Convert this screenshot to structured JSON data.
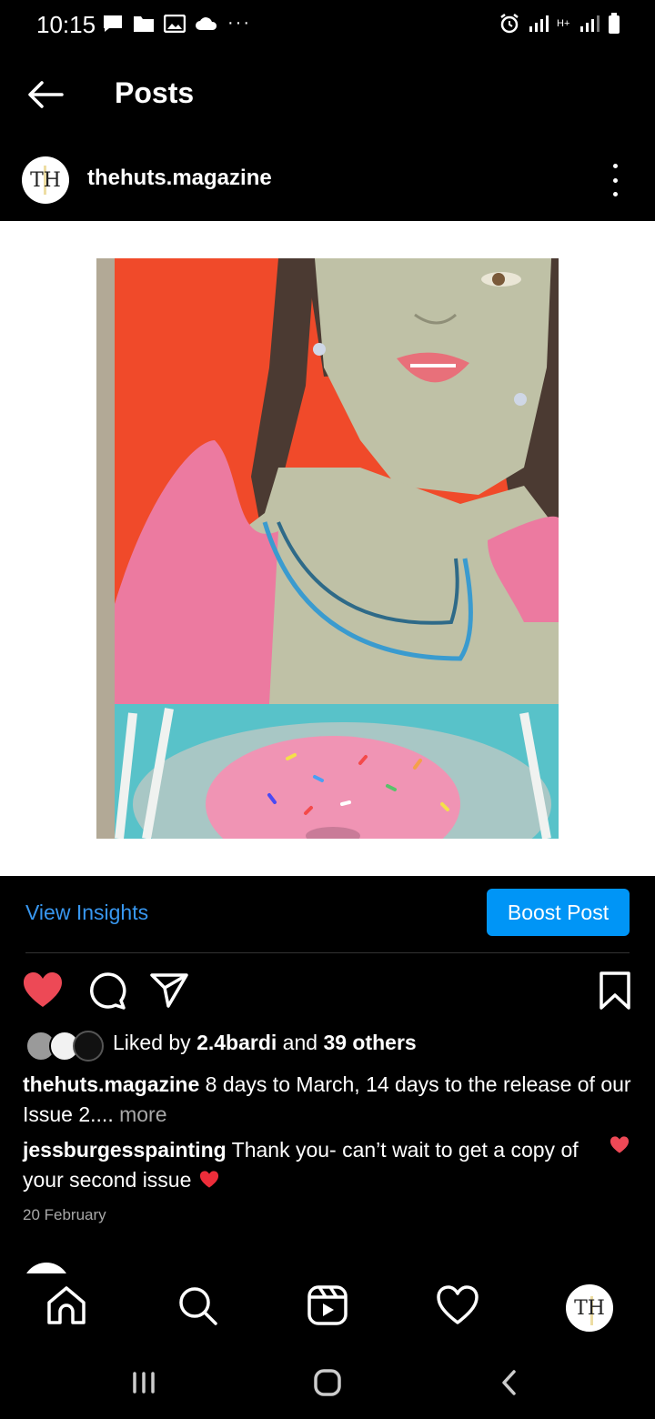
{
  "status_bar": {
    "time": "10:15",
    "more": "···",
    "network": "H+"
  },
  "header": {
    "title": "Posts",
    "back_icon": "arrow-left-icon"
  },
  "profile": {
    "avatar_text": "TH",
    "username": "thehuts.magazine",
    "menu_icon": "more-vertical-icon"
  },
  "post": {
    "image": "painting-woman-donut"
  },
  "insights": {
    "view_insights": "View Insights",
    "boost_post": "Boost Post"
  },
  "actions": {
    "like_icon": "heart-filled-icon",
    "comment_icon": "comment-icon",
    "share_icon": "send-icon",
    "save_icon": "bookmark-icon"
  },
  "likes": {
    "prefix": "Liked by ",
    "user": "2.4bardi",
    "middle": " and ",
    "others": "39 others"
  },
  "caption": {
    "username": "thehuts.magazine",
    "text": " 8 days to March, 14 days to the release of our Issue 2....",
    "more": " more"
  },
  "comment": {
    "username": "jessburgesspainting",
    "text": " Thank you- can’t wait to get a copy of your second issue "
  },
  "date": "20 February",
  "bottom_nav": {
    "profile_avatar_text": "TH"
  },
  "colors": {
    "accent_blue": "#0095f6",
    "link_blue": "#3897f0",
    "heart_red": "#ed4956"
  }
}
